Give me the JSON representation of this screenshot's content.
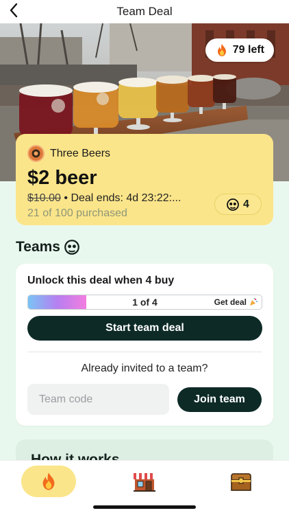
{
  "header": {
    "title": "Team Deal",
    "back_icon": "chevron-left-icon"
  },
  "hero": {
    "remaining_label": "79 left",
    "remaining_icon": "fire-icon"
  },
  "deal": {
    "merchant_name": "Three Beers",
    "title": "$2 beer",
    "original_price": "$10.00",
    "separator": " • ",
    "ends_text": "Deal ends: 4d 23:22:...",
    "purchased_text": "21 of 100 purchased",
    "team_size_label": "4"
  },
  "teams": {
    "heading": "Teams",
    "unlock_text": "Unlock this deal when 4 buy",
    "progress_text": "1 of 4",
    "progress_fraction": 0.25,
    "progress_cta": "Get deal",
    "start_button": "Start team deal",
    "invited_text": "Already invited to a team?",
    "code_placeholder": "Team code",
    "join_button": "Join team"
  },
  "how_it_works": {
    "title": "How it works"
  },
  "tabs": [
    {
      "name": "deals",
      "icon": "fire-icon",
      "active": true
    },
    {
      "name": "shop",
      "icon": "store-icon",
      "active": false
    },
    {
      "name": "chest",
      "icon": "treasure-chest-icon",
      "active": false
    }
  ],
  "colors": {
    "accent_yellow": "#fbe58a",
    "dark_green": "#0d2a27",
    "mint_bg": "#e9f8ee"
  }
}
